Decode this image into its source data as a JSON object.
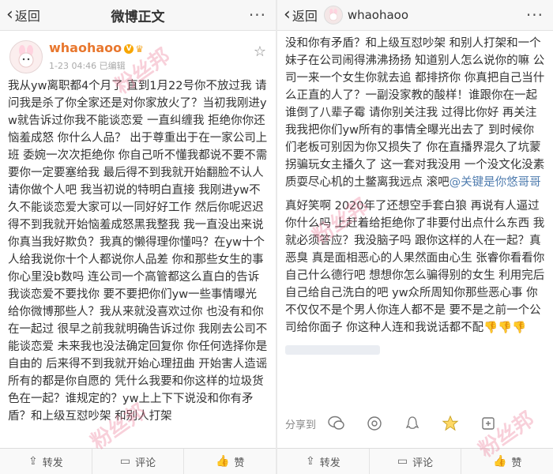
{
  "left": {
    "back_label": "返回",
    "title": "微博正文",
    "more": "···",
    "username": "whaohaoo",
    "time": "1-23 04:46",
    "edited": "已编辑",
    "post_text": "我从yw离职都4个月了 直到1月22号你不放过我 请问我是杀了你全家还是对你家放火了？当初我刚进yw就告诉过你我不能谈恋爱 一直纠缠我 拒绝你你还恼羞成怒 你什么人品？ 出于尊重出于在一家公司上班 委婉一次次拒绝你 你自己听不懂我都说不要不需要你一定要塞给我 最后得不到我就开始翻脸不认人 请你做个人吧 我当初说的特明白直接 我刚进yw不久不能谈恋爱大家可以一同好好工作 然后你呢迟迟得不到我就开始恼羞成怒黑我整我 我一直没出来说你真当我好欺负？我真的懒得理你懂吗？在yw十个人给我说你十个人都说你人品差 你和那些女生的事你心里没b数吗 连公司一个高管都这么直白的告诉我谈恋爱不要找你 要不要把你们yw一些事情曝光给你微博那些人？我从来就没喜欢过你 也没有和你在一起过 很早之前我就明确告诉过你 我刚去公司不能谈恋爱 未来我也没法确定回复你 你任何选择你是自由的 后来得不到我就开始心理扭曲 开始害人造谣 所有的都是你自愿的 凭什么我要和你这样的垃圾货色在一起？谁规定的？yw上上下下说没和你有矛盾？和上级互怼吵架 和别人打架",
    "actions": {
      "repost": "转发",
      "comment": "评论",
      "like": "赞"
    }
  },
  "right": {
    "back_label": "返回",
    "title": "whaohaoo",
    "more": "···",
    "post_text_a": "没和你有矛盾？和上级互怼吵架 和别人打架和一个妹子在公司闹得沸沸扬扬 知道别人怎么说你的嘛 公司一来一个女生你就去追 都排挤你 你真把自己当什么正直的人了？一副没家教的酸样！谁跟你在一起谁倒了八辈子霉 请你别关注我 过得比你好 再关注我我把你们yw所有的事情全曝光出去了 到时候你们老板可别因为你又损失了 你在直播界混久了坑蒙拐骗玩女主播久了 这一套对我没用 一个没文化没素质耍尽心机的土鳖离我远点 滚吧",
    "mention": "@关键是你悠哥哥",
    "post_text_b": "真好笑啊 2020年了还想空手套白狼 再说有人逼过你什么吗 上赶着给拒绝你了非要付出点什么东西 我就必须答应？我没脑子吗 跟你这样的人在一起？真恶臭 真是面相恶心的人果然面由心生 张睿你看看你自己什么德行吧 想想你怎么骗得别的女生 利用完后自己给自己洗白的吧 yw众所周知你那些恶心事 你不仅仅不是个男人你连人都不是 要不是之前一个公司给你面子 你这种人连和我说话都不配",
    "thumbs": "👎👎👎",
    "share_label": "分享到",
    "actions": {
      "repost": "转发",
      "comment": "评论",
      "like": "赞"
    }
  },
  "watermark": "粉丝邦",
  "colors": {
    "username": "#e8772e",
    "mention": "#507daf"
  }
}
